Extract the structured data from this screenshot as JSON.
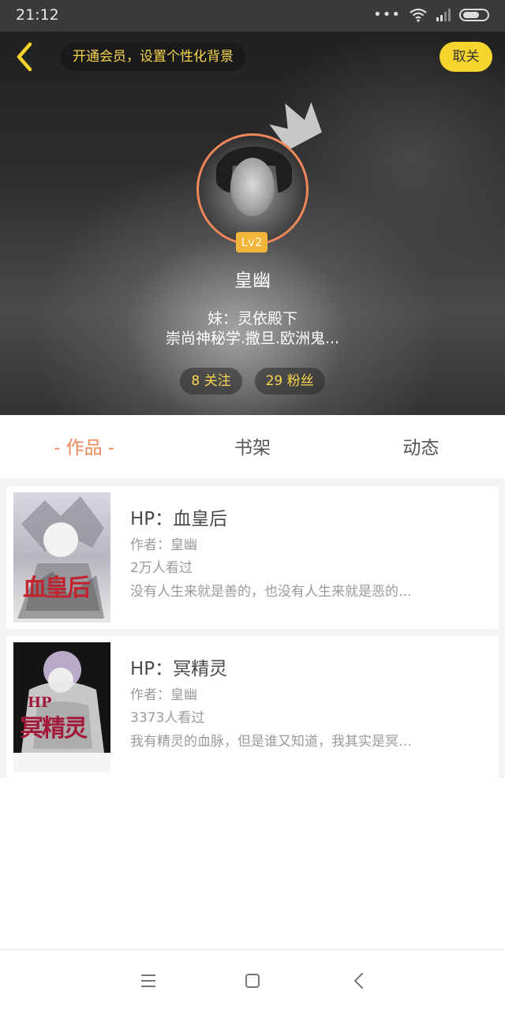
{
  "status_bar": {
    "time": "21:12",
    "dots": "•••"
  },
  "header": {
    "vip_banner": "开通会员，设置个性化背景",
    "close_label": "取关"
  },
  "profile": {
    "level": "Lv2",
    "username": "皇幽",
    "bio_line1": "妹：灵依殿下",
    "bio_line2": "崇尚神秘学.撒旦.欧洲鬼...",
    "follow_count": "8 关注",
    "fans_count": "29 粉丝"
  },
  "tabs": [
    {
      "label": "- 作品 -",
      "active": true
    },
    {
      "label": "书架",
      "active": false
    },
    {
      "label": "动态",
      "active": false
    }
  ],
  "books": [
    {
      "title": "HP：血皇后",
      "author": "作者：皇幽",
      "views": "2万人看过",
      "desc": "没有人生来就是善的，也没有人生来就是恶的…",
      "cover_text": "血皇后"
    },
    {
      "title": "HP：冥精灵",
      "author": "作者：皇幽",
      "views": "3373人看过",
      "desc": "我有精灵的血脉，但是谁又知道，我其实是冥…",
      "cover_text": "冥精灵",
      "cover_prefix": "HP"
    }
  ],
  "colors": {
    "accent": "#f0875a",
    "vip_yellow": "#f8d64e",
    "close_button": "#f7d52c",
    "level_badge": "#f3b63a"
  },
  "icons": {
    "back": "chevron-left-icon",
    "crown": "crown-icon",
    "nav_menu": "menu-icon",
    "nav_home": "home-square-icon",
    "nav_back": "back-triangle-icon"
  }
}
